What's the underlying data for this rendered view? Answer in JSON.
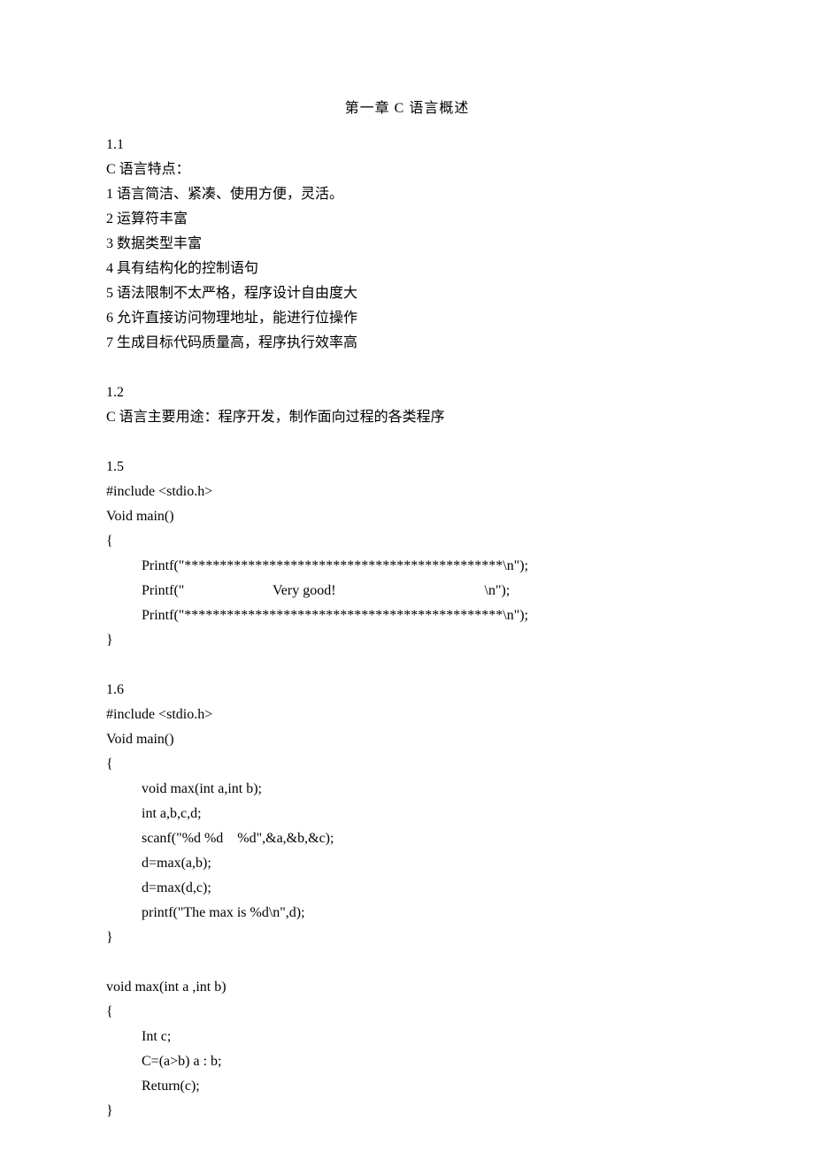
{
  "title": "第一章 C 语言概述",
  "s11": {
    "heading": "1.1",
    "intro": "C 语言特点：",
    "items": [
      "1 语言简洁、紧凑、使用方便，灵活。",
      "2 运算符丰富",
      "3 数据类型丰富",
      "4 具有结构化的控制语句",
      "5 语法限制不太严格，程序设计自由度大",
      "6 允许直接访问物理地址，能进行位操作",
      "7 生成目标代码质量高，程序执行效率高"
    ]
  },
  "s12": {
    "heading": "1.2",
    "text": "C 语言主要用途：程序开发，制作面向过程的各类程序"
  },
  "s15": {
    "heading": "1.5",
    "lines": [
      "#include <stdio.h>",
      "Void main()",
      "{"
    ],
    "body": [
      "Printf(\"*********************************************\\n\");",
      "Printf(\"                         Very good!                                          \\n\");",
      "Printf(\"*********************************************\\n\");"
    ],
    "close": "}"
  },
  "s16": {
    "heading": "1.6",
    "lines": [
      "#include <stdio.h>",
      "Void main()",
      "{"
    ],
    "body": [
      "void max(int a,int b);",
      "int a,b,c,d;",
      "scanf(\"%d %d    %d\",&a,&b,&c);",
      "d=max(a,b);",
      "d=max(d,c);",
      "printf(\"The max is %d\\n\",d);"
    ],
    "close": "}"
  },
  "func": {
    "sig": "void max(int a ,int b)",
    "open": "{",
    "body": [
      "Int c;",
      "C=(a>b) a : b;",
      "Return(c);"
    ],
    "close": "}"
  }
}
